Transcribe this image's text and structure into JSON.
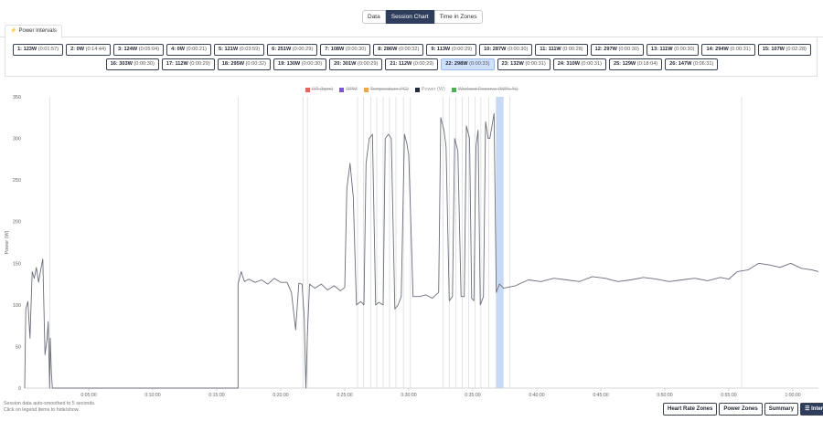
{
  "view_toggle": {
    "data": "Data",
    "session_chart": "Session Chart",
    "time_in_zones": "Time in Zones"
  },
  "tab": {
    "label": "Power Intervals"
  },
  "intervals": [
    {
      "label": "1: 123W",
      "duration": "(0:01:57)"
    },
    {
      "label": "2: 0W",
      "duration": "(0:14:44)"
    },
    {
      "label": "3: 124W",
      "duration": "(0:05:04)"
    },
    {
      "label": "4: 0W",
      "duration": "(0:00:21)"
    },
    {
      "label": "5: 121W",
      "duration": "(0:03:59)"
    },
    {
      "label": "6: 251W",
      "duration": "(0:00:29)"
    },
    {
      "label": "7: 108W",
      "duration": "(0:00:30)"
    },
    {
      "label": "8: 286W",
      "duration": "(0:00:32)"
    },
    {
      "label": "9: 113W",
      "duration": "(0:00:29)"
    },
    {
      "label": "10: 287W",
      "duration": "(0:00:30)"
    },
    {
      "label": "11: 111W",
      "duration": "(0:00:28)"
    },
    {
      "label": "12: 297W",
      "duration": "(0:00:30)"
    },
    {
      "label": "13: 111W",
      "duration": "(0:00:30)"
    },
    {
      "label": "14: 294W",
      "duration": "(0:00:31)"
    },
    {
      "label": "15: 107W",
      "duration": "(0:02:28)"
    },
    {
      "label": "16: 303W",
      "duration": "(0:00:30)"
    },
    {
      "label": "17: 112W",
      "duration": "(0:00:29)"
    },
    {
      "label": "18: 295W",
      "duration": "(0:00:32)"
    },
    {
      "label": "19: 130W",
      "duration": "(0:00:30)"
    },
    {
      "label": "20: 301W",
      "duration": "(0:00:29)"
    },
    {
      "label": "21: 112W",
      "duration": "(0:00:29)"
    },
    {
      "label": "22: 298W",
      "duration": "(0:00:33)",
      "selected": true
    },
    {
      "label": "23: 132W",
      "duration": "(0:00:31)"
    },
    {
      "label": "24: 310W",
      "duration": "(0:00:31)"
    },
    {
      "label": "25: 129W",
      "duration": "(0:18:04)"
    },
    {
      "label": "26: 147W",
      "duration": "(0:06:31)"
    }
  ],
  "legend": [
    {
      "label": "HR (bpm)",
      "color": "#e8665a",
      "active": false
    },
    {
      "label": "RPM",
      "color": "#7b57d6",
      "active": false
    },
    {
      "label": "Temperature (°C)",
      "color": "#f2a540",
      "active": false
    },
    {
      "label": "Power (W)",
      "color": "#262a3e",
      "active": true
    },
    {
      "label": "Workout Reserve (W/% %)",
      "color": "#4caf50",
      "active": false
    }
  ],
  "chart_data": {
    "type": "line",
    "ylabel": "Power (W)",
    "ylim": [
      0,
      350
    ],
    "yticks": [
      0,
      50,
      100,
      150,
      200,
      250,
      300,
      350
    ],
    "xlim": [
      0,
      3720
    ],
    "xtick_labels": [
      "0:05:00",
      "0:10:00",
      "0:15:00",
      "0:20:00",
      "0:25:00",
      "0:30:00",
      "0:35:00",
      "0:40:00",
      "0:45:00",
      "0:50:00",
      "0:55:00",
      "1:00:00"
    ],
    "xtick_seconds": [
      300,
      600,
      900,
      1200,
      1500,
      1800,
      2100,
      2400,
      2700,
      3000,
      3300,
      3600
    ],
    "series": [
      {
        "name": "Power (W)",
        "color": "#6b6e7a",
        "points": [
          [
            0,
            0
          ],
          [
            5,
            95
          ],
          [
            15,
            104
          ],
          [
            25,
            60
          ],
          [
            35,
            140
          ],
          [
            45,
            132
          ],
          [
            55,
            145
          ],
          [
            65,
            127
          ],
          [
            75,
            142
          ],
          [
            85,
            155
          ],
          [
            95,
            40
          ],
          [
            105,
            60
          ],
          [
            110,
            80
          ],
          [
            117,
            0
          ],
          [
            120,
            60
          ],
          [
            125,
            18
          ],
          [
            130,
            0
          ],
          [
            300,
            0
          ],
          [
            600,
            0
          ],
          [
            900,
            0
          ],
          [
            1000,
            0
          ],
          [
            1000,
            125
          ],
          [
            1015,
            140
          ],
          [
            1030,
            128
          ],
          [
            1050,
            131
          ],
          [
            1080,
            127
          ],
          [
            1110,
            130
          ],
          [
            1140,
            125
          ],
          [
            1170,
            132
          ],
          [
            1200,
            127
          ],
          [
            1230,
            127
          ],
          [
            1250,
            115
          ],
          [
            1270,
            70
          ],
          [
            1285,
            126
          ],
          [
            1300,
            125
          ],
          [
            1310,
            85
          ],
          [
            1318,
            0
          ],
          [
            1325,
            65
          ],
          [
            1335,
            125
          ],
          [
            1360,
            120
          ],
          [
            1390,
            125
          ],
          [
            1420,
            118
          ],
          [
            1450,
            123
          ],
          [
            1480,
            117
          ],
          [
            1500,
            121
          ],
          [
            1510,
            240
          ],
          [
            1525,
            270
          ],
          [
            1540,
            230
          ],
          [
            1555,
            100
          ],
          [
            1575,
            104
          ],
          [
            1590,
            100
          ],
          [
            1600,
            270
          ],
          [
            1615,
            300
          ],
          [
            1630,
            305
          ],
          [
            1645,
            100
          ],
          [
            1660,
            103
          ],
          [
            1680,
            100
          ],
          [
            1690,
            300
          ],
          [
            1705,
            305
          ],
          [
            1718,
            300
          ],
          [
            1735,
            95
          ],
          [
            1750,
            100
          ],
          [
            1765,
            110
          ],
          [
            1780,
            305
          ],
          [
            1790,
            295
          ],
          [
            1800,
            280
          ],
          [
            1820,
            110
          ],
          [
            1850,
            110
          ],
          [
            1880,
            112
          ],
          [
            1910,
            108
          ],
          [
            1940,
            115
          ],
          [
            1950,
            325
          ],
          [
            1965,
            310
          ],
          [
            1975,
            290
          ],
          [
            1990,
            105
          ],
          [
            2005,
            110
          ],
          [
            2015,
            300
          ],
          [
            2030,
            285
          ],
          [
            2045,
            110
          ],
          [
            2060,
            110
          ],
          [
            2070,
            315
          ],
          [
            2085,
            300
          ],
          [
            2095,
            108
          ],
          [
            2105,
            105
          ],
          [
            2115,
            290
          ],
          [
            2125,
            310
          ],
          [
            2135,
            100
          ],
          [
            2150,
            110
          ],
          [
            2160,
            320
          ],
          [
            2172,
            300
          ],
          [
            2180,
            300
          ],
          [
            2190,
            315
          ],
          [
            2200,
            330
          ],
          [
            2210,
            115
          ],
          [
            2225,
            125
          ],
          [
            2245,
            120
          ],
          [
            2300,
            123
          ],
          [
            2360,
            130
          ],
          [
            2420,
            128
          ],
          [
            2480,
            132
          ],
          [
            2540,
            130
          ],
          [
            2600,
            128
          ],
          [
            2660,
            134
          ],
          [
            2720,
            132
          ],
          [
            2780,
            128
          ],
          [
            2840,
            130
          ],
          [
            2900,
            133
          ],
          [
            2960,
            131
          ],
          [
            3020,
            128
          ],
          [
            3080,
            130
          ],
          [
            3140,
            132
          ],
          [
            3200,
            129
          ],
          [
            3260,
            133
          ],
          [
            3300,
            131
          ],
          [
            3340,
            140
          ],
          [
            3390,
            142
          ],
          [
            3440,
            150
          ],
          [
            3490,
            148
          ],
          [
            3540,
            145
          ],
          [
            3590,
            150
          ],
          [
            3640,
            144
          ],
          [
            3690,
            142
          ],
          [
            3720,
            140
          ]
        ]
      }
    ],
    "highlight_range": [
      2210,
      2243
    ],
    "interval_boundaries": [
      117,
      1000,
      1304,
      1325,
      1560,
      1588,
      1622,
      1650,
      1680,
      1710,
      1740,
      1775,
      1808,
      1960,
      1990,
      2020,
      2050,
      2080,
      2110,
      2138,
      2175,
      2210,
      2243,
      2274,
      3360
    ]
  },
  "notes": {
    "line1": "Session data auto-smoothed to 5 seconds.",
    "line2": "Click on legend items to hide/show."
  },
  "bottom_buttons": {
    "heart_rate_zones": "Heart Rate Zones",
    "power_zones": "Power Zones",
    "summary": "Summary",
    "intervals": "☰ Intervals"
  }
}
